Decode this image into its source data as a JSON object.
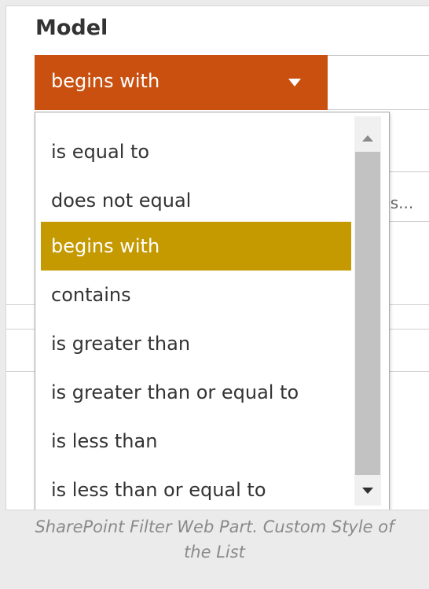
{
  "field": {
    "label": "Model"
  },
  "operator_select": {
    "value": "begins with",
    "caret_icon": "caret-down-icon",
    "background_color": "#ca5010"
  },
  "background_input": {
    "partial_text": ":s..."
  },
  "dropdown": {
    "options": [
      {
        "label": "is equal to"
      },
      {
        "label": "does not equal"
      },
      {
        "label": "begins with",
        "selected": true
      },
      {
        "label": "contains"
      },
      {
        "label": "is greater than"
      },
      {
        "label": "is greater than or equal to"
      },
      {
        "label": "is less than"
      },
      {
        "label": "is less than or equal to"
      }
    ],
    "selected_color": "#c49a00",
    "scroll_up_icon": "scroll-up-arrow-icon",
    "scroll_down_icon": "scroll-down-arrow-icon"
  },
  "caption": {
    "line1": "SharePoint Filter Web Part. Custom Style of",
    "line2": "the List"
  }
}
